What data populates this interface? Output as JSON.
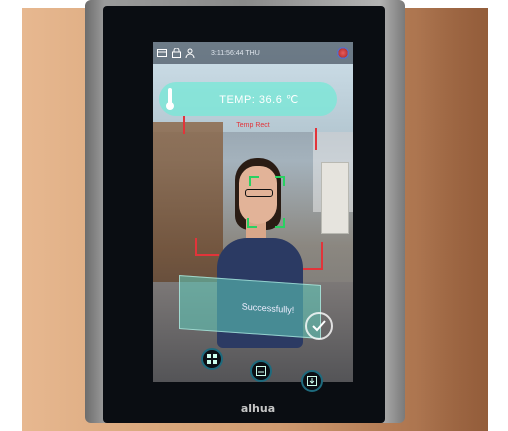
{
  "status_bar": {
    "datetime": "3:11:56:44 THU",
    "icons": [
      "card-icon",
      "lock-icon",
      "person-icon"
    ],
    "brand_icon": "app-logo-icon"
  },
  "temperature": {
    "label": "TEMP: 36.6 ℃",
    "icon": "thermometer-icon"
  },
  "temp_rect_label": "Temp Rect",
  "recognition": {
    "message": "Successfully!",
    "icon": "check-circle-icon"
  },
  "bottom_buttons": [
    "grid-icon",
    "card-icon",
    "download-icon"
  ],
  "device_brand": "alhua",
  "colors": {
    "banner": "#78e8d7",
    "face_box": "#29d162",
    "temp_rect": "#e2343a",
    "accent_top": "#2f9fe0"
  }
}
